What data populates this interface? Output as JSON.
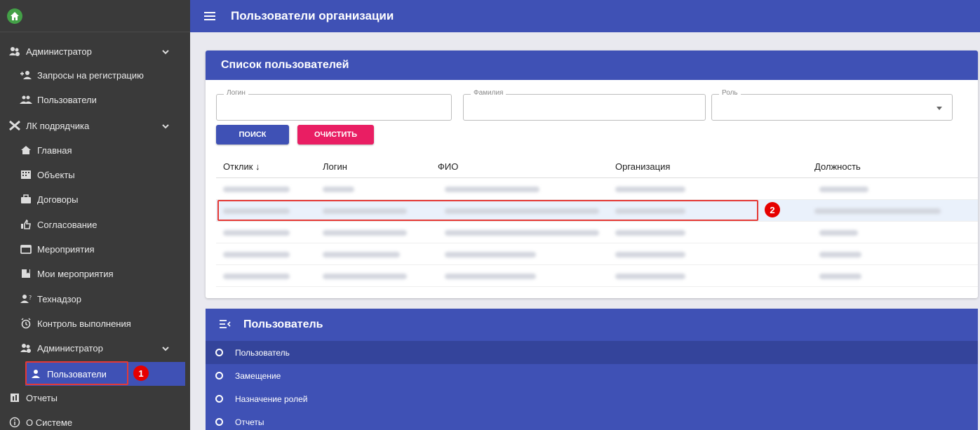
{
  "sidebar": {
    "items": [
      {
        "label": "Администратор",
        "icon": "admin-group-icon"
      },
      {
        "label": "Запросы на регистрацию",
        "icon": "add-user-icon"
      },
      {
        "label": "Пользователи",
        "icon": "users-icon"
      },
      {
        "label": "ЛК подрядчика",
        "icon": "tools-icon"
      },
      {
        "label": "Главная",
        "icon": "home-icon"
      },
      {
        "label": "Объекты",
        "icon": "building-icon"
      },
      {
        "label": "Договоры",
        "icon": "briefcase-icon"
      },
      {
        "label": "Согласование",
        "icon": "thumb-up-icon"
      },
      {
        "label": "Мероприятия",
        "icon": "calendar-icon"
      },
      {
        "label": "Мои мероприятия",
        "icon": "bookmark-icon"
      },
      {
        "label": "Технадзор",
        "icon": "inspector-icon"
      },
      {
        "label": "Контроль выполнения",
        "icon": "alarm-icon"
      },
      {
        "label": "Администратор",
        "icon": "admin-group-icon"
      },
      {
        "label": "Пользователи",
        "icon": "user-icon"
      },
      {
        "label": "Отчеты",
        "icon": "report-icon"
      },
      {
        "label": "О Системе",
        "icon": "info-icon"
      }
    ],
    "annotation_1": "1"
  },
  "topbar": {
    "title": "Пользователи организации"
  },
  "user_list": {
    "title": "Список пользователей",
    "fields": {
      "login": "Логин",
      "surname": "Фамилия",
      "role": "Роль"
    },
    "search_button": "ПОИСК",
    "clear_button": "ОЧИСТИТЬ",
    "columns": [
      "Отклик ↓",
      "Логин",
      "ФИО",
      "Организация",
      "Должность"
    ],
    "annotation_2": "2"
  },
  "user_panel": {
    "title": "Пользователь",
    "items": [
      "Пользователь",
      "Замещение",
      "Назначение ролей",
      "Отчеты"
    ]
  },
  "colors": {
    "primary": "#3f51b5",
    "accent": "#e91e63",
    "sidebar": "#3a3a3a",
    "annotation": "#e53935"
  }
}
